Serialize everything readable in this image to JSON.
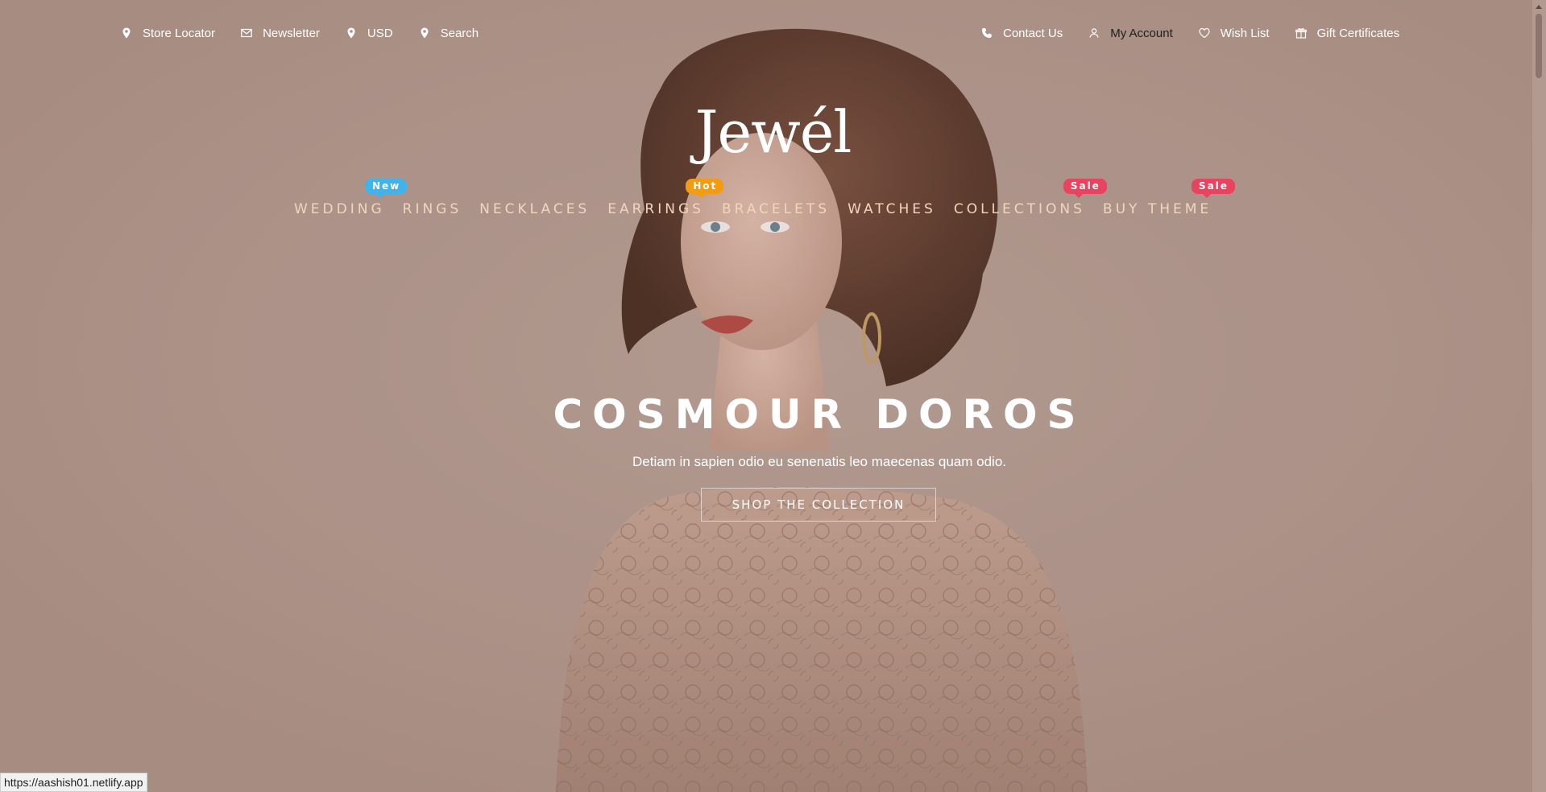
{
  "topbar": {
    "left": [
      {
        "icon": "map-pin-icon",
        "label": "Store Locator"
      },
      {
        "icon": "mail-icon",
        "label": "Newsletter"
      },
      {
        "icon": "map-pin-icon",
        "label": "USD"
      },
      {
        "icon": "map-pin-icon",
        "label": "Search"
      }
    ],
    "right": [
      {
        "icon": "phone-icon",
        "label": "Contact Us"
      },
      {
        "icon": "user-icon",
        "label": "My Account"
      },
      {
        "icon": "heart-icon",
        "label": "Wish List"
      },
      {
        "icon": "gift-icon",
        "label": "Gift Certificates"
      }
    ]
  },
  "logo": "Jewél",
  "nav": [
    {
      "label": "WEDDING",
      "badge": "New"
    },
    {
      "label": "RINGS"
    },
    {
      "label": "NECKLACES"
    },
    {
      "label": "EARRINGS",
      "badge": "Hot"
    },
    {
      "label": "BRACELETS"
    },
    {
      "label": "WATCHES"
    },
    {
      "label": "COLLECTIONS",
      "badge": "Sale"
    },
    {
      "label": "BUY THEME",
      "badge": "Sale"
    }
  ],
  "badge_colors": {
    "new": "#3fb3ea",
    "hot": "#f39c12",
    "sale": "#e8435f"
  },
  "hero": {
    "title": "COSMOUR DOROS",
    "subtitle": "Detiam in sapien odio eu senenatis leo maecenas quam odio.",
    "button_label": "SHOP THE COLLECTION"
  },
  "status_url": "https://aashish01.netlify.app",
  "colors": {
    "background": "#b59c92",
    "nav_text": "#f2d6bb",
    "text": "#ffffff"
  }
}
